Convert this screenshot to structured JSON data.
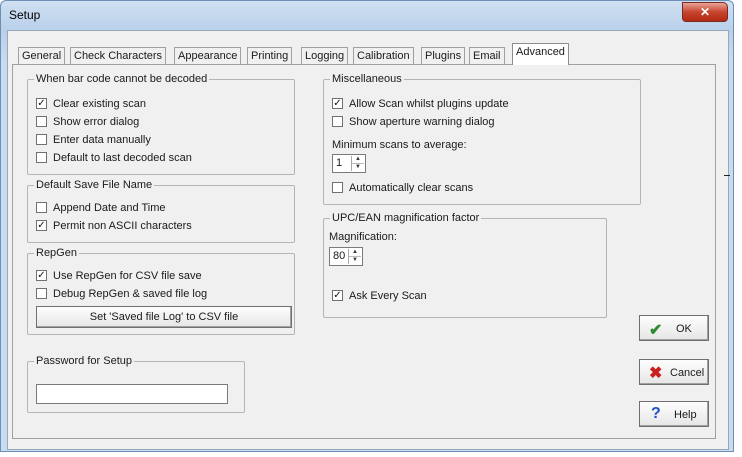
{
  "window": {
    "title": "Setup",
    "close_glyph": "✕"
  },
  "tabs": [
    "General",
    "Check Characters",
    "Appearance",
    "Printing",
    "Logging",
    "Calibration",
    "Plugins",
    "Email",
    "Advanced"
  ],
  "active_tab": "Advanced",
  "decode_group": {
    "label": "When bar code cannot be decoded",
    "options": [
      {
        "label": "Clear existing scan",
        "checked": true
      },
      {
        "label": "Show error dialog",
        "checked": false
      },
      {
        "label": "Enter data manually",
        "checked": false
      },
      {
        "label": "Default to last decoded scan",
        "checked": false
      }
    ]
  },
  "save_group": {
    "label": "Default Save File Name",
    "options": [
      {
        "label": "Append Date and Time",
        "checked": false
      },
      {
        "label": "Permit non ASCII characters",
        "checked": true
      }
    ]
  },
  "repgen_group": {
    "label": "RepGen",
    "options": [
      {
        "label": "Use RepGen for CSV file save",
        "checked": true
      },
      {
        "label": "Debug RepGen & saved file log",
        "checked": false
      }
    ],
    "button_label": "Set 'Saved file Log' to CSV file"
  },
  "password_group": {
    "label": "Password for Setup",
    "value": ""
  },
  "misc_group": {
    "label": "Miscellaneous",
    "options": [
      {
        "label": "Allow Scan whilst plugins update",
        "checked": true
      },
      {
        "label": "Show aperture warning dialog",
        "checked": false
      }
    ],
    "min_scans_label": "Minimum scans to average:",
    "min_scans_value": "1",
    "auto_clear": {
      "label": "Automatically clear scans",
      "checked": false
    }
  },
  "magnification_group": {
    "label": "UPC/EAN magnification factor",
    "magnification_label": "Magnification:",
    "magnification_value": "80",
    "ask_every_scan": {
      "label": "Ask Every Scan",
      "checked": true
    }
  },
  "buttons": {
    "ok": "OK",
    "cancel": "Cancel",
    "help": "Help"
  },
  "colors": {
    "ok_icon": "#2e8b2e",
    "cancel_icon": "#cc1f1f",
    "help_icon": "#1f4fcc",
    "close": "#c7442e"
  }
}
